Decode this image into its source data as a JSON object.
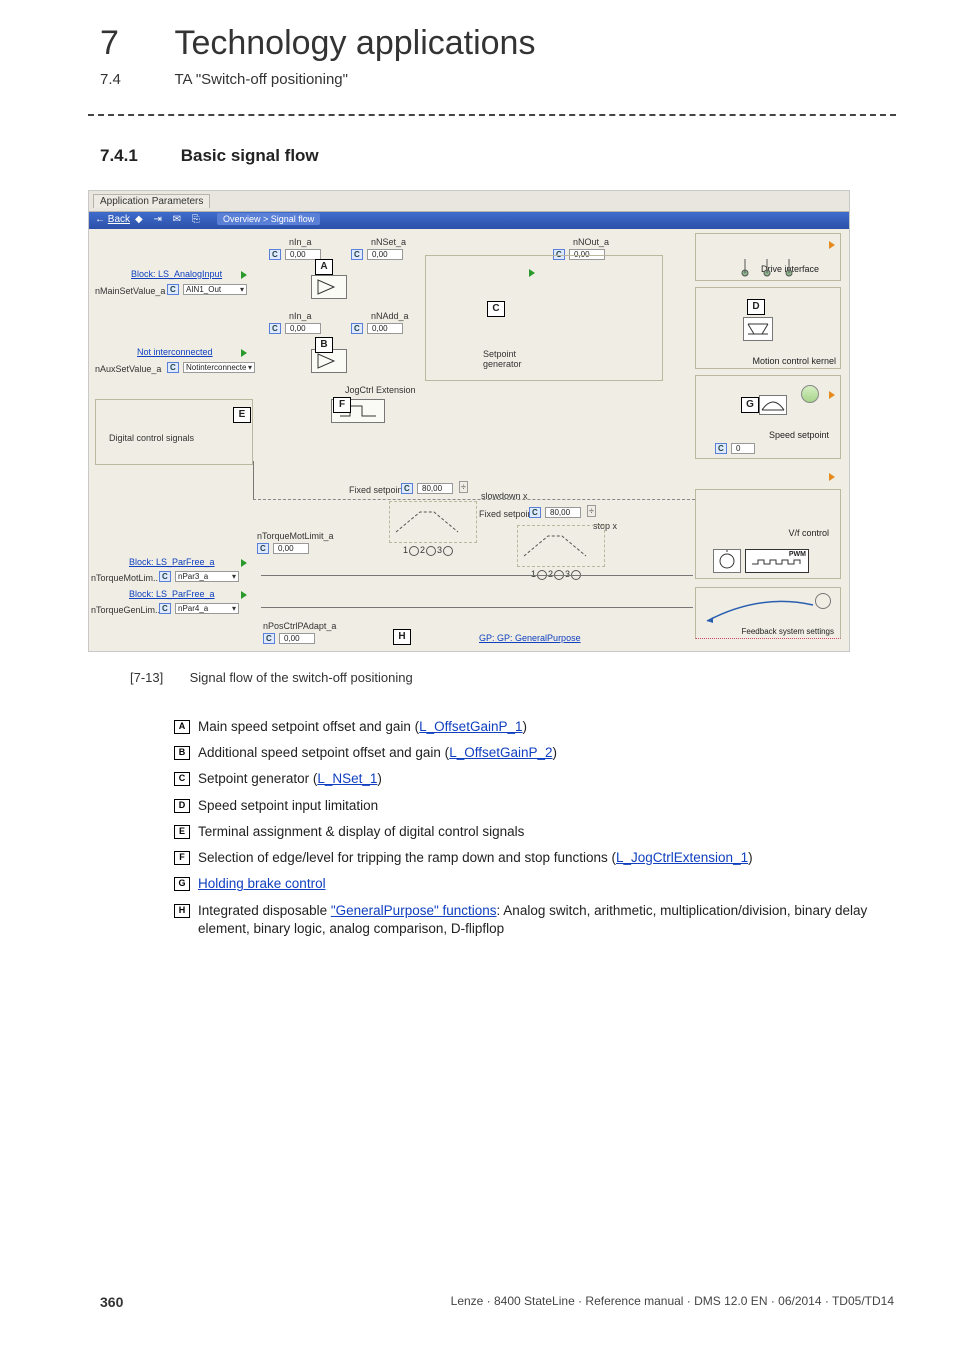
{
  "header": {
    "chapter_number": "7",
    "chapter_title": "Technology applications",
    "section_number": "7.4",
    "section_title": "TA \"Switch-off positioning\""
  },
  "subsection": {
    "number": "7.4.1",
    "title": "Basic signal flow"
  },
  "screenshot": {
    "tab_label": "Application Parameters",
    "back_label": "Back",
    "breadcrumb": "Overview > Signal flow",
    "labels": {
      "block_analog": "Block: LS_AnalogInput",
      "main_set": "nMainSetValue_a",
      "ain1": "AIN1_Out",
      "not_inter": "Not interconnected",
      "aux_set": "nAuxSetValue_a",
      "not_inter2": "Notinterconnecte",
      "dig_ctrl": "Digital control signals",
      "jog_ext": "JogCtrl Extension",
      "nin_a": "nIn_a",
      "nadd_a": "nNAdd_a",
      "nnset_a": "nNSet_a",
      "nnout_a": "nNOut_a",
      "setpoint_gen": "Setpoint\ngenerator",
      "drive_if": "Drive interface",
      "mck": "Motion control kernel",
      "speed_sp": "Speed setpoint",
      "vf": "V/f control",
      "fdbk": "Feedback system settings",
      "fixed_sp": "Fixed setpoin..",
      "slowdown": "slowdown x",
      "stopx": "stop x",
      "ntorque_mot_lim": "nTorqueMotLimit_a",
      "block_parfree": "Block: LS_ParFree_a",
      "ntorqmot": "nTorqueMotLim..",
      "npar3": "nPar3_a",
      "ntorqgen": "nTorqueGenLim..",
      "npar4": "nPar4_a",
      "nposctrl": "nPosCtrlPAdapt_a",
      "gp": "GP: GeneralPurpose",
      "v000": "0,00",
      "v80": "80,00",
      "v0": "0",
      "radios": "1    2    3"
    },
    "markers": {
      "A": "A",
      "B": "B",
      "C": "C",
      "D": "D",
      "E": "E",
      "F": "F",
      "G": "G",
      "H": "H"
    }
  },
  "figure": {
    "tag": "[7-13]",
    "caption": "Signal flow of the switch-off positioning"
  },
  "legend": {
    "A": {
      "pre": "Main speed setpoint offset and gain (",
      "link": "L_OffsetGainP_1",
      "post": ")"
    },
    "B": {
      "pre": "Additional speed setpoint offset and gain (",
      "link": "L_OffsetGainP_2",
      "post": ")"
    },
    "C": {
      "pre": "Setpoint generator (",
      "link": "L_NSet_1",
      "post": ")"
    },
    "D": {
      "text": "Speed setpoint input limitation"
    },
    "E": {
      "text": "Terminal assignment & display of digital control signals"
    },
    "F": {
      "pre": "Selection of edge/level for tripping the ramp down and stop functions (",
      "link": "L_JogCtrlExtension_1",
      "post": ")"
    },
    "G": {
      "link": "Holding brake control"
    },
    "H": {
      "pre": "Integrated disposable ",
      "link": "\"GeneralPurpose\" functions",
      "post": ": Analog switch, arithmetic, multiplication/division, binary delay element, binary logic, analog comparison, D-flipflop"
    }
  },
  "footer": {
    "page": "360",
    "source": "Lenze · 8400 StateLine · Reference manual · DMS 12.0 EN · 06/2014 · TD05/TD14"
  }
}
